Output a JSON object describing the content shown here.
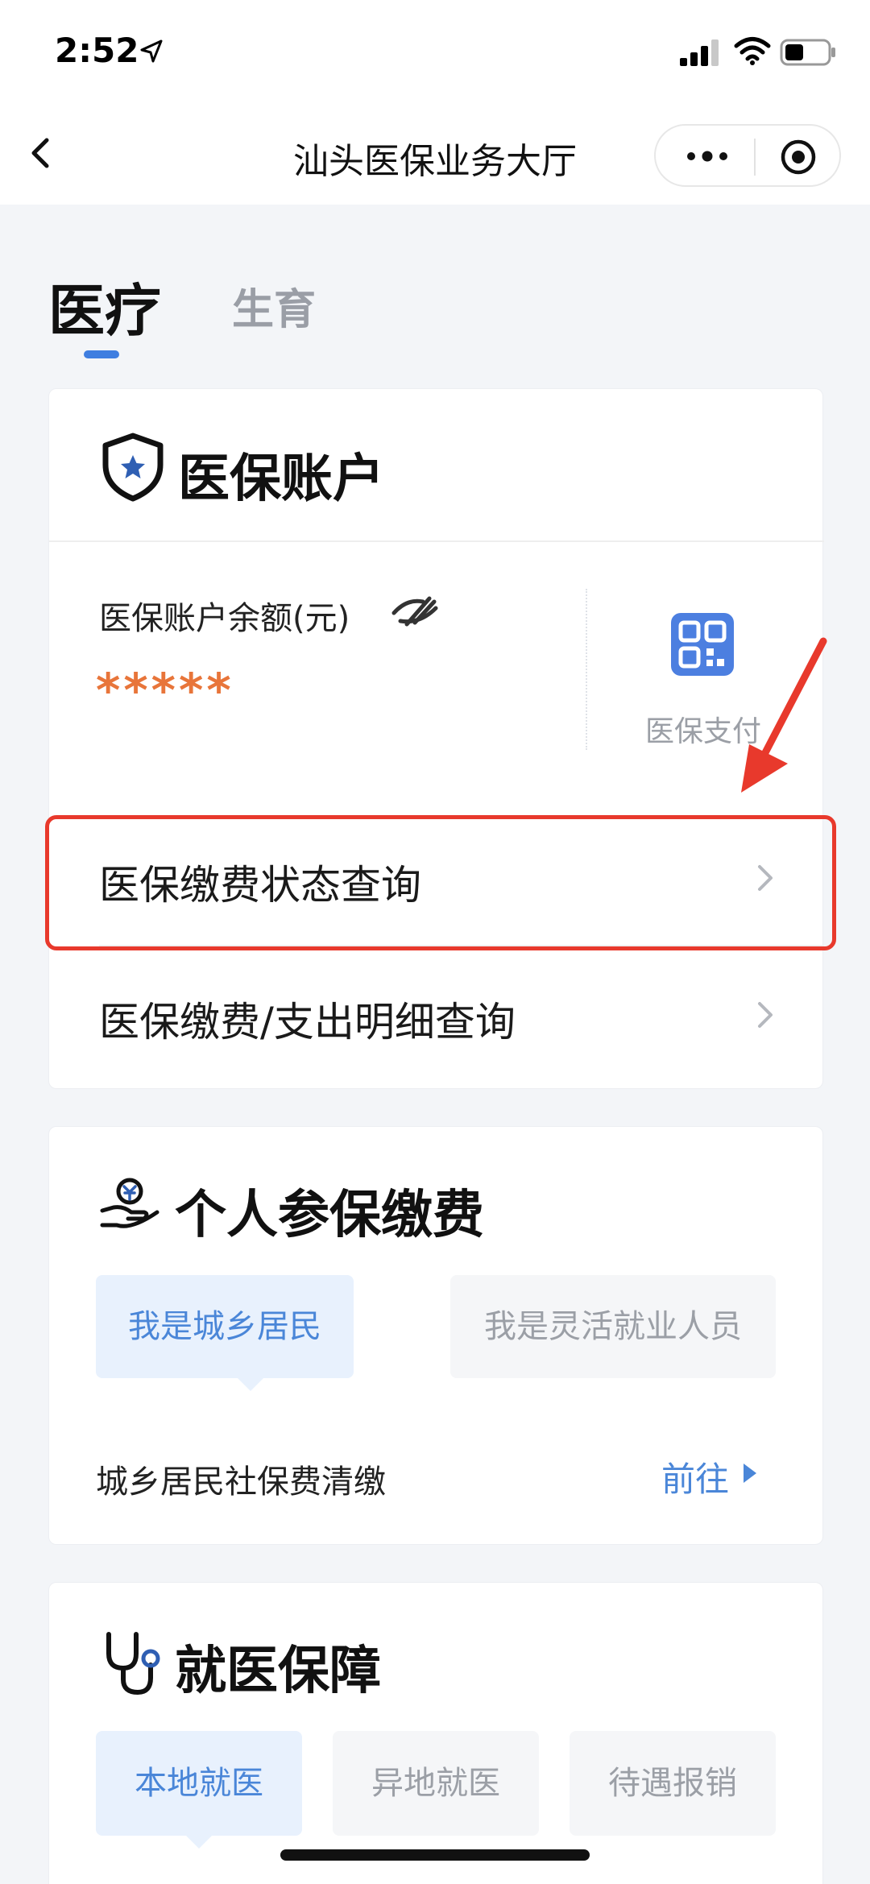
{
  "status_bar": {
    "time": "2:52"
  },
  "nav": {
    "title": "汕头医保业务大厅"
  },
  "tabs": [
    {
      "label": "医疗",
      "active": true
    },
    {
      "label": "生育",
      "active": false
    }
  ],
  "account_card": {
    "title": "医保账户",
    "balance_label": "医保账户余额(元)",
    "balance_value": "*****",
    "qr_label": "医保支付",
    "rows": [
      {
        "label": "医保缴费状态查询",
        "highlighted": true
      },
      {
        "label": "医保缴费/支出明细查询",
        "highlighted": false
      }
    ]
  },
  "pay_card": {
    "title": "个人参保缴费",
    "options": [
      "我是城乡居民",
      "我是灵活就业人员"
    ],
    "selected_option": "我是城乡居民",
    "row_label": "城乡居民社保费清缴",
    "link_label": "前往"
  },
  "care_card": {
    "title": "就医保障",
    "options": [
      "本地就医",
      "异地就医",
      "待遇报销"
    ],
    "selected_option": "本地就医"
  },
  "colors": {
    "accent": "#3f7ee0",
    "balance": "#e8753a",
    "annotation": "#e8392c"
  }
}
